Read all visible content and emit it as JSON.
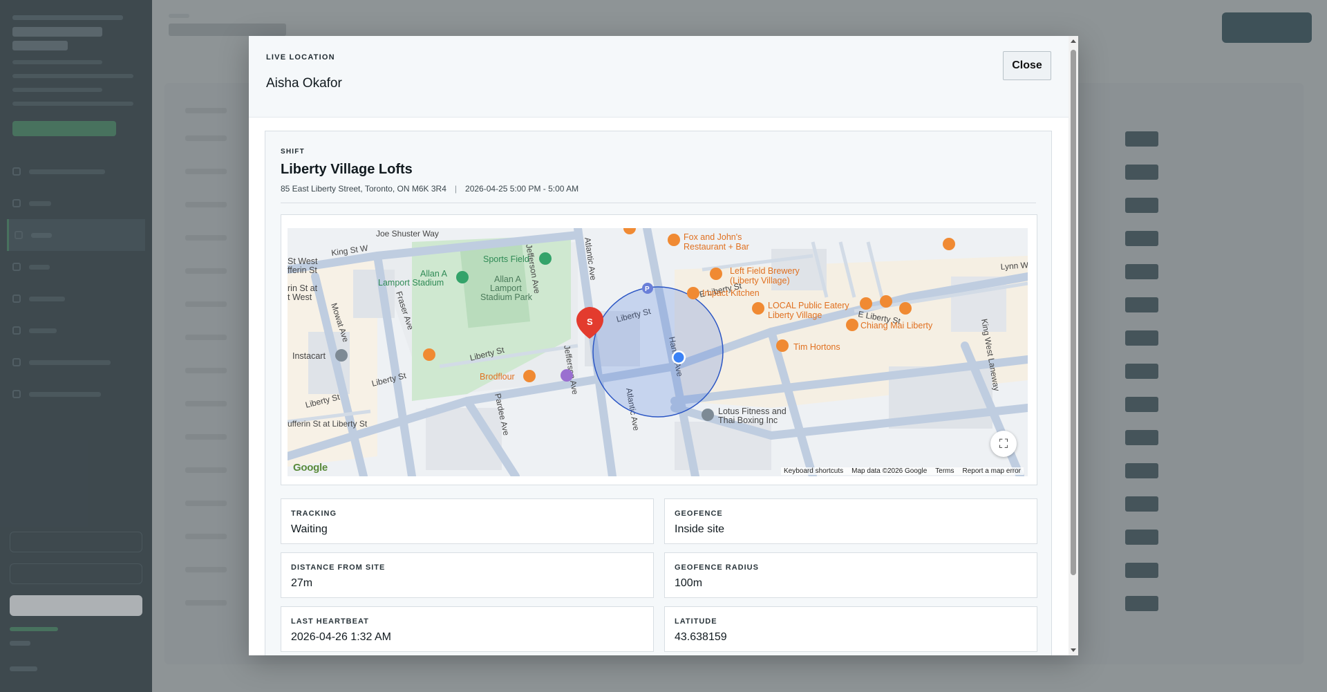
{
  "modal": {
    "eyebrow": "LIVE LOCATION",
    "title": "Aisha Okafor",
    "close_label": "Close"
  },
  "shift": {
    "eyebrow": "SHIFT",
    "title": "Liberty Village Lofts",
    "address": "85 East Liberty Street, Toronto, ON M6K 3R4",
    "separator": "|",
    "time": "2026-04-25 5:00 PM - 5:00 AM"
  },
  "map": {
    "labels": {
      "joe_shuster": "Joe Shuster Way",
      "king_st_w": "King St W",
      "st_west_dufferin": "St West\nfferin St",
      "sports_field": "Sports Field",
      "allan_a_lamport": "Allan A\nLamport Stadium",
      "allan_park": "Allan A\nLamport\nStadium Park",
      "rin_st": "rin St at\nt West",
      "jefferson_top": "Jefferson Ave",
      "atlantic_top": "Atlantic Ave",
      "fox_john": "Fox and John's\nRestaurant + Bar",
      "left_field": "Left Field Brewery\n(Liberty Village)",
      "lynn_williams": "Lynn Williams St",
      "impact_kitchen": "Impact Kitchen",
      "e_liberty_st": "E Liberty St",
      "local_eatery": "LOCAL Public Eatery\nLiberty Village",
      "chiang_mai": "Chiang Mai Liberty",
      "e_liberty_right": "E Liberty St",
      "liberty_st_mid": "Liberty St",
      "tim_hortons": "Tim Hortons",
      "hanna_ave": "Hanna Ave",
      "king_west_laneway": "King West Laneway",
      "instacart": "Instacart",
      "mowat_ave": "Mowat Ave",
      "fraser_ave": "Fraser Ave",
      "liberty_st_left": "Liberty St",
      "liberty_st_left2": "Liberty St",
      "liberty_st_bottom": "Liberty St",
      "dufferin_liberty": "ufferin St at Liberty St",
      "brodflour": "Brodflour",
      "pardee_ave": "Pardee Ave",
      "jefferson_bottom": "Jefferson Ave",
      "atlantic_bottom": "Atlantic Ave",
      "lotus_fitness": "Lotus Fitness and\nThai Boxing Inc",
      "site_marker": "S",
      "parking": "P"
    },
    "footer": {
      "shortcuts": "Keyboard shortcuts",
      "map_data": "Map data ©2026 Google",
      "terms": "Terms",
      "report": "Report a map error"
    },
    "logo": "Google",
    "colors": {
      "geofence": "#3b6fdc",
      "poi_food": "#f08a33",
      "site_pin": "#e33b2e",
      "guard_dot": "#3b82f6",
      "park": "#cfe8d0"
    }
  },
  "stats": {
    "tracking": {
      "label": "TRACKING",
      "value": "Waiting"
    },
    "geofence": {
      "label": "GEOFENCE",
      "value": "Inside site"
    },
    "distance": {
      "label": "DISTANCE FROM SITE",
      "value": "27m"
    },
    "radius": {
      "label": "GEOFENCE RADIUS",
      "value": "100m"
    },
    "heartbeat": {
      "label": "LAST HEARTBEAT",
      "value": "2026-04-26 1:32 AM"
    },
    "latitude": {
      "label": "LATITUDE",
      "value": "43.638159"
    }
  }
}
